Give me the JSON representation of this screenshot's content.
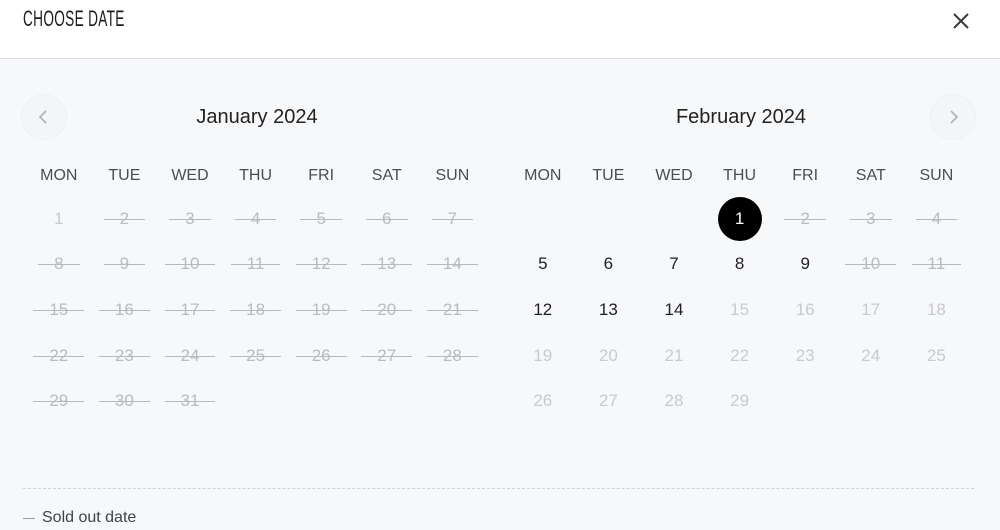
{
  "header": {
    "title": "CHOOSE DATE",
    "close_icon": "close-icon"
  },
  "nav": {
    "prev_icon": "chevron-left-icon",
    "next_icon": "chevron-right-icon"
  },
  "weekdays": [
    "MON",
    "TUE",
    "WED",
    "THU",
    "FRI",
    "SAT",
    "SUN"
  ],
  "months": [
    {
      "title": "January 2024",
      "offset": 0,
      "days": [
        {
          "d": "1",
          "s": "disabled"
        },
        {
          "d": "2",
          "s": "sold"
        },
        {
          "d": "3",
          "s": "sold"
        },
        {
          "d": "4",
          "s": "sold"
        },
        {
          "d": "5",
          "s": "sold"
        },
        {
          "d": "6",
          "s": "sold"
        },
        {
          "d": "7",
          "s": "sold"
        },
        {
          "d": "8",
          "s": "sold"
        },
        {
          "d": "9",
          "s": "sold"
        },
        {
          "d": "10",
          "s": "sold"
        },
        {
          "d": "11",
          "s": "sold"
        },
        {
          "d": "12",
          "s": "sold"
        },
        {
          "d": "13",
          "s": "sold"
        },
        {
          "d": "14",
          "s": "sold"
        },
        {
          "d": "15",
          "s": "sold"
        },
        {
          "d": "16",
          "s": "sold"
        },
        {
          "d": "17",
          "s": "sold"
        },
        {
          "d": "18",
          "s": "sold"
        },
        {
          "d": "19",
          "s": "sold"
        },
        {
          "d": "20",
          "s": "sold"
        },
        {
          "d": "21",
          "s": "sold"
        },
        {
          "d": "22",
          "s": "sold"
        },
        {
          "d": "23",
          "s": "sold"
        },
        {
          "d": "24",
          "s": "sold"
        },
        {
          "d": "25",
          "s": "sold"
        },
        {
          "d": "26",
          "s": "sold"
        },
        {
          "d": "27",
          "s": "sold"
        },
        {
          "d": "28",
          "s": "sold"
        },
        {
          "d": "29",
          "s": "sold"
        },
        {
          "d": "30",
          "s": "sold"
        },
        {
          "d": "31",
          "s": "sold"
        }
      ]
    },
    {
      "title": "February 2024",
      "offset": 3,
      "days": [
        {
          "d": "1",
          "s": "selected"
        },
        {
          "d": "2",
          "s": "sold"
        },
        {
          "d": "3",
          "s": "sold"
        },
        {
          "d": "4",
          "s": "sold"
        },
        {
          "d": "5",
          "s": "avail"
        },
        {
          "d": "6",
          "s": "avail"
        },
        {
          "d": "7",
          "s": "avail"
        },
        {
          "d": "8",
          "s": "avail"
        },
        {
          "d": "9",
          "s": "avail"
        },
        {
          "d": "10",
          "s": "sold"
        },
        {
          "d": "11",
          "s": "sold"
        },
        {
          "d": "12",
          "s": "avail"
        },
        {
          "d": "13",
          "s": "avail"
        },
        {
          "d": "14",
          "s": "avail"
        },
        {
          "d": "15",
          "s": "disabled"
        },
        {
          "d": "16",
          "s": "disabled"
        },
        {
          "d": "17",
          "s": "disabled"
        },
        {
          "d": "18",
          "s": "disabled"
        },
        {
          "d": "19",
          "s": "disabled"
        },
        {
          "d": "20",
          "s": "disabled"
        },
        {
          "d": "21",
          "s": "disabled"
        },
        {
          "d": "22",
          "s": "disabled"
        },
        {
          "d": "23",
          "s": "disabled"
        },
        {
          "d": "24",
          "s": "disabled"
        },
        {
          "d": "25",
          "s": "disabled"
        },
        {
          "d": "26",
          "s": "disabled"
        },
        {
          "d": "27",
          "s": "disabled"
        },
        {
          "d": "28",
          "s": "disabled"
        },
        {
          "d": "29",
          "s": "disabled"
        }
      ]
    }
  ],
  "legend": {
    "sold_out_label": "Sold out date"
  },
  "colors": {
    "selected_bg": "#000000",
    "available_text": "#1f1f22",
    "disabled_text": "#c2c4c8"
  }
}
